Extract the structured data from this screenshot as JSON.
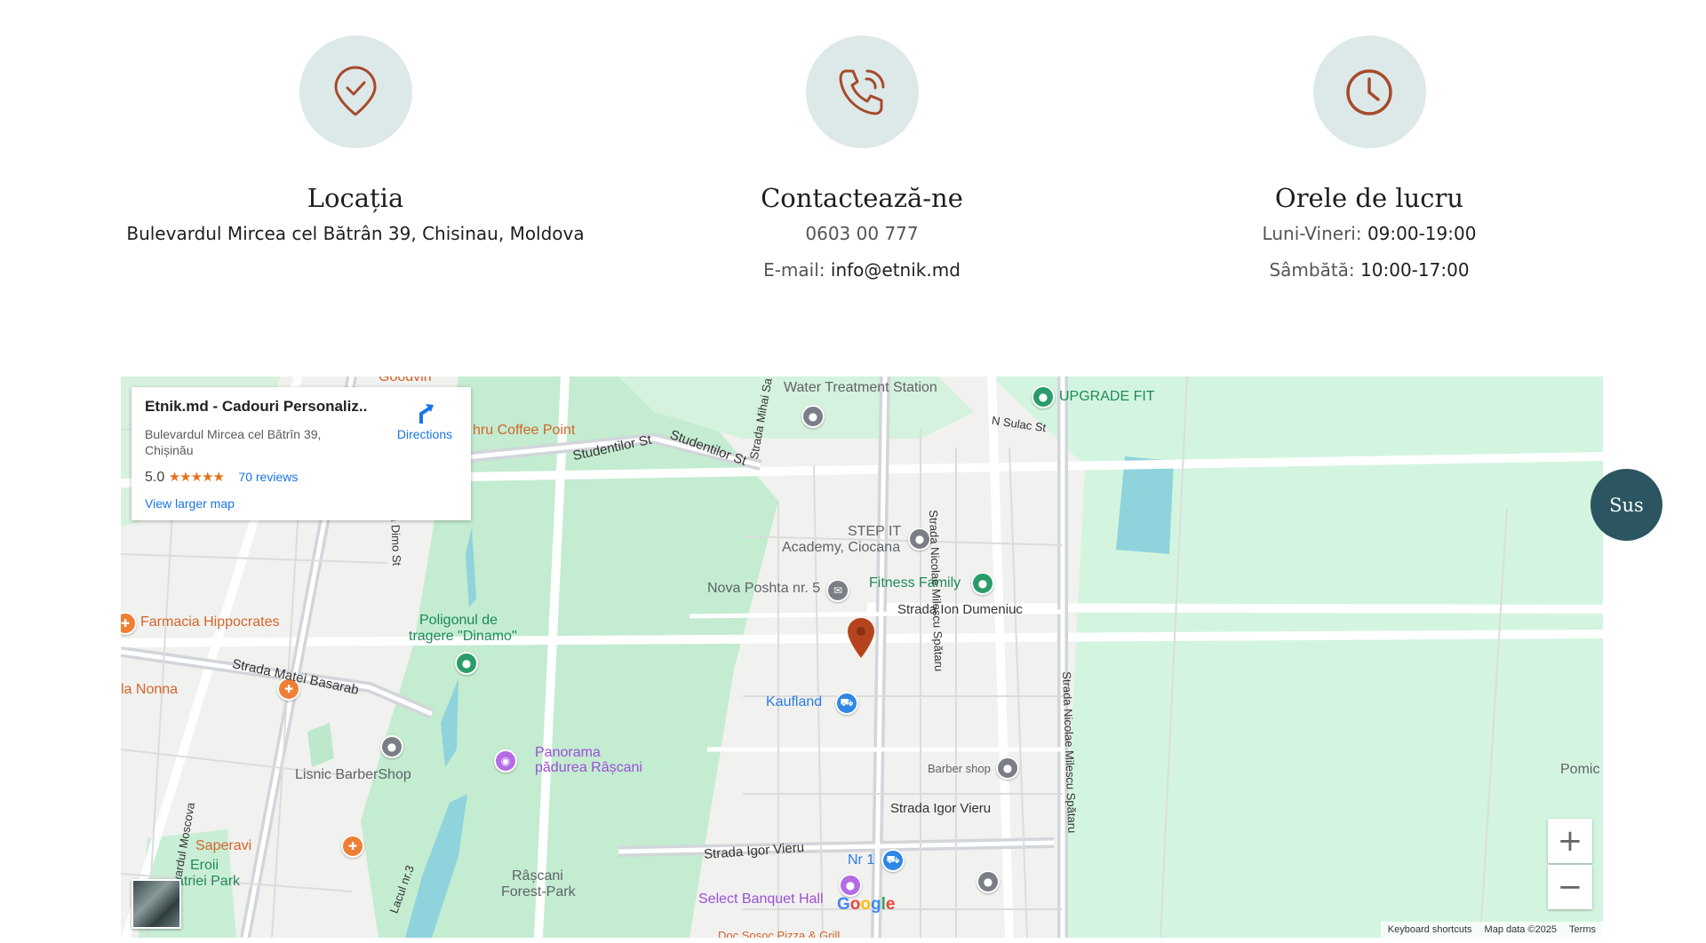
{
  "info": {
    "location": {
      "title": "Locația",
      "address": "Bulevardul Mircea cel Bătrân 39, Chisinau, Moldova",
      "icon": "shield-check-icon"
    },
    "contact": {
      "title": "Contactează-ne",
      "phone": "0603 00 777",
      "email_label": "E-mail:",
      "email": "info@etnik.md",
      "icon": "phone-call-icon"
    },
    "hours": {
      "title": "Orele de lucru",
      "weekdays_label": "Luni-Vineri:",
      "weekdays": "09:00-19:00",
      "saturday_label": "Sâmbătă:",
      "saturday": "10:00-17:00",
      "icon": "clock-icon"
    }
  },
  "colors": {
    "accent": "#a64a2b",
    "icon_bg": "#dde9e9",
    "sus_bg": "#2b5560"
  },
  "map": {
    "card": {
      "name": "Etnik.md - Cadouri Personaliz...",
      "address": "Bulevardul Mircea cel Bătrîn 39, Chișinău",
      "rating": "5.0",
      "stars": "★★★★★",
      "reviews": "70 reviews",
      "larger_map": "View larger map",
      "directions": "Directions"
    },
    "labels": {
      "water": "Water Treatment Station",
      "upgrade": "UPGRADE FIT",
      "nsulac": "N Sulac St",
      "coffee": "hru Coffee Point",
      "studentilor1": "Studentilor St",
      "studentilor2": "Studentilor St",
      "mihai": "Strada Mihai Sa",
      "step1": "STEP IT",
      "step2": "Academy, Ciocana",
      "nova": "Nova Poshta nr. 5",
      "fitness": "Fitness Family",
      "dumeniuc": "Strada Ion Dumeniuc",
      "milescu1": "Strada Nicolae Milescu Spătaru",
      "milescu2": "Strada Nicolae Milescu Spătaru",
      "farmacia": "Farmacia Hippocrates",
      "poligon1": "Poligonul de",
      "poligon2": "tragere \"Dinamo\"",
      "matei": "Strada Matei Basarab",
      "nonna": "la Nonna",
      "kaufland": "Kaufland",
      "panorama1": "Panorama",
      "panorama2": "pădurea Râșcani",
      "lisnic": "Lisnic BarberShop",
      "barber": "Barber shop",
      "igor1": "Strada Igor Vieru",
      "igor2": "Strada Igor Vieru",
      "moscova": "Bulevardul Moscova",
      "saperavi": "Saperavi",
      "eroii1": "Eroii",
      "eroii2": "atriei Park",
      "rascani1": "Râșcani",
      "rascani2": "Forest-Park",
      "nr1": "Nr 1",
      "select": "Select Banquet Hall",
      "lacul": "Lacul nr.3",
      "dimo": "lia Dimo St",
      "pomic": "Pomic",
      "goodvin": "Goodvin",
      "pizza": "Doc Sosoc Pizza & Grill"
    },
    "google": "Google",
    "attribution": {
      "shortcuts": "Keyboard shortcuts",
      "data": "Map data ©2025",
      "terms": "Terms"
    }
  },
  "sus_label": "Sus"
}
